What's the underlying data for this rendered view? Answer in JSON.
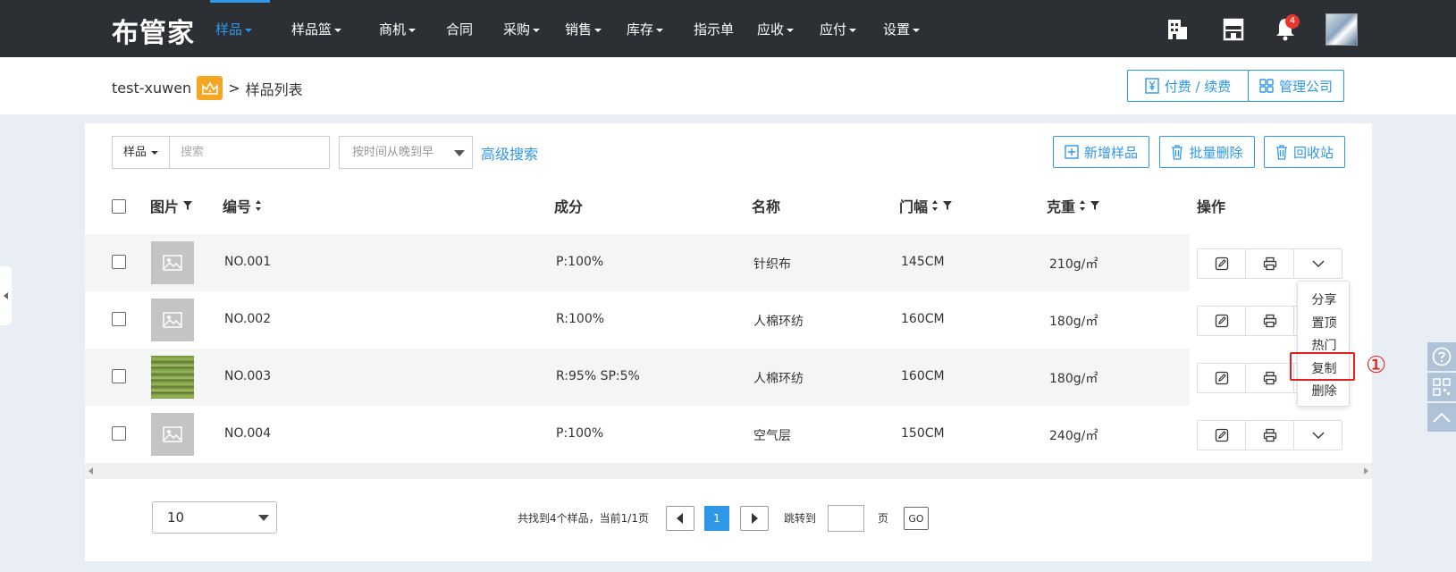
{
  "app": {
    "logo": "布管家"
  },
  "nav": {
    "items": [
      {
        "label": "样品",
        "caret": true,
        "active": true
      },
      {
        "label": "样品篮",
        "caret": true
      },
      {
        "label": "商机",
        "caret": true
      },
      {
        "label": "合同",
        "caret": false
      },
      {
        "label": "采购",
        "caret": true
      },
      {
        "label": "销售",
        "caret": true
      },
      {
        "label": "库存",
        "caret": true
      },
      {
        "label": "指示单",
        "caret": false
      },
      {
        "label": "应收",
        "caret": true
      },
      {
        "label": "应付",
        "caret": true
      },
      {
        "label": "设置",
        "caret": true
      }
    ],
    "notification_count": "4"
  },
  "breadcrumb": {
    "company": "test-xuwen",
    "separator": ">",
    "page": "样品列表"
  },
  "header_actions": {
    "pay_label": "付费 / 续费",
    "manage_label": "管理公司"
  },
  "toolbar": {
    "type_select": "样品",
    "search_placeholder": "搜索",
    "sort_select": "按时间从晚到早",
    "advanced_search": "高级搜索",
    "add_label": "新增样品",
    "batch_delete_label": "批量删除",
    "recycle_label": "回收站"
  },
  "table": {
    "columns": {
      "image": "图片",
      "code": "编号",
      "composition": "成分",
      "name": "名称",
      "width": "门幅",
      "weight": "克重",
      "ops": "操作"
    },
    "rows": [
      {
        "code": "NO.001",
        "composition": "P:100%",
        "name": "针织布",
        "width": "145CM",
        "weight": "210g/㎡",
        "thumb": "placeholder"
      },
      {
        "code": "NO.002",
        "composition": "R:100%",
        "name": "人棉环纺",
        "width": "160CM",
        "weight": "180g/㎡",
        "thumb": "placeholder"
      },
      {
        "code": "NO.003",
        "composition": "R:95% SP:5%",
        "name": "人棉环纺",
        "width": "160CM",
        "weight": "180g/㎡",
        "thumb": "fabric"
      },
      {
        "code": "NO.004",
        "composition": "P:100%",
        "name": "空气层",
        "width": "150CM",
        "weight": "240g/㎡",
        "thumb": "placeholder"
      }
    ]
  },
  "row_menu": {
    "items": [
      "分享",
      "置顶",
      "热门",
      "复制",
      "删除"
    ],
    "highlighted": "复制"
  },
  "annotation": {
    "marker": "①"
  },
  "pagination": {
    "page_size": "10",
    "summary": "共找到4个样品，当前1/1页",
    "current_page": "1",
    "jump_label": "跳转到",
    "page_unit": "页",
    "go_label": "GO"
  },
  "colors": {
    "accent": "#2f97e8",
    "nav_bg": "#2c3035",
    "highlight": "#e02020",
    "crown": "#f5a623"
  }
}
